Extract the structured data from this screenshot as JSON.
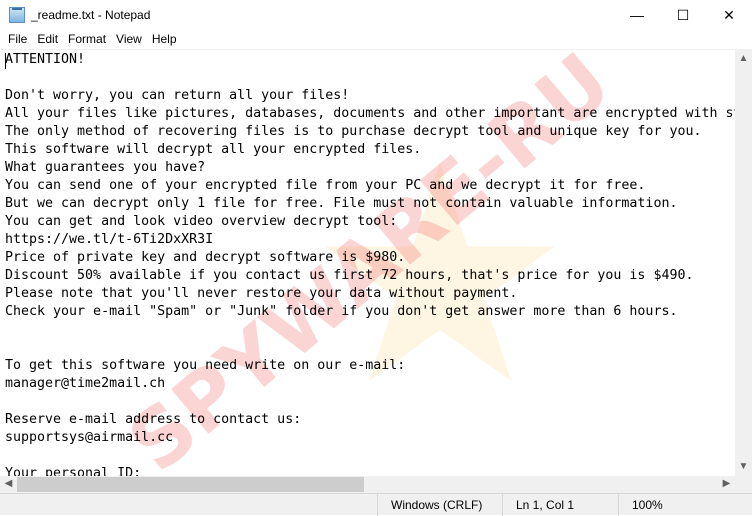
{
  "window": {
    "title": "_readme.txt - Notepad",
    "minimize": "—",
    "maximize": "☐",
    "close": "✕"
  },
  "menu": [
    "File",
    "Edit",
    "Format",
    "View",
    "Help"
  ],
  "content": "ATTENTION!\n\nDon't worry, you can return all your files!\nAll your files like pictures, databases, documents and other important are encrypted with strongest encryption and unique key.\nThe only method of recovering files is to purchase decrypt tool and unique key for you.\nThis software will decrypt all your encrypted files.\nWhat guarantees you have?\nYou can send one of your encrypted file from your PC and we decrypt it for free.\nBut we can decrypt only 1 file for free. File must not contain valuable information.\nYou can get and look video overview decrypt tool:\nhttps://we.tl/t-6Ti2DxXR3I\nPrice of private key and decrypt software is $980.\nDiscount 50% available if you contact us first 72 hours, that's price for you is $490.\nPlease note that you'll never restore your data without payment.\nCheck your e-mail \"Spam\" or \"Junk\" folder if you don't get answer more than 6 hours.\n\n\nTo get this software you need write on our e-mail:\nmanager@time2mail.ch\n\nReserve e-mail address to contact us:\nsupportsys@airmail.cc\n\nYour personal ID:",
  "watermark": "SPYWARE-RU",
  "status": {
    "line_ending": "Windows (CRLF)",
    "position": "Ln 1, Col 1",
    "zoom": "100%"
  }
}
